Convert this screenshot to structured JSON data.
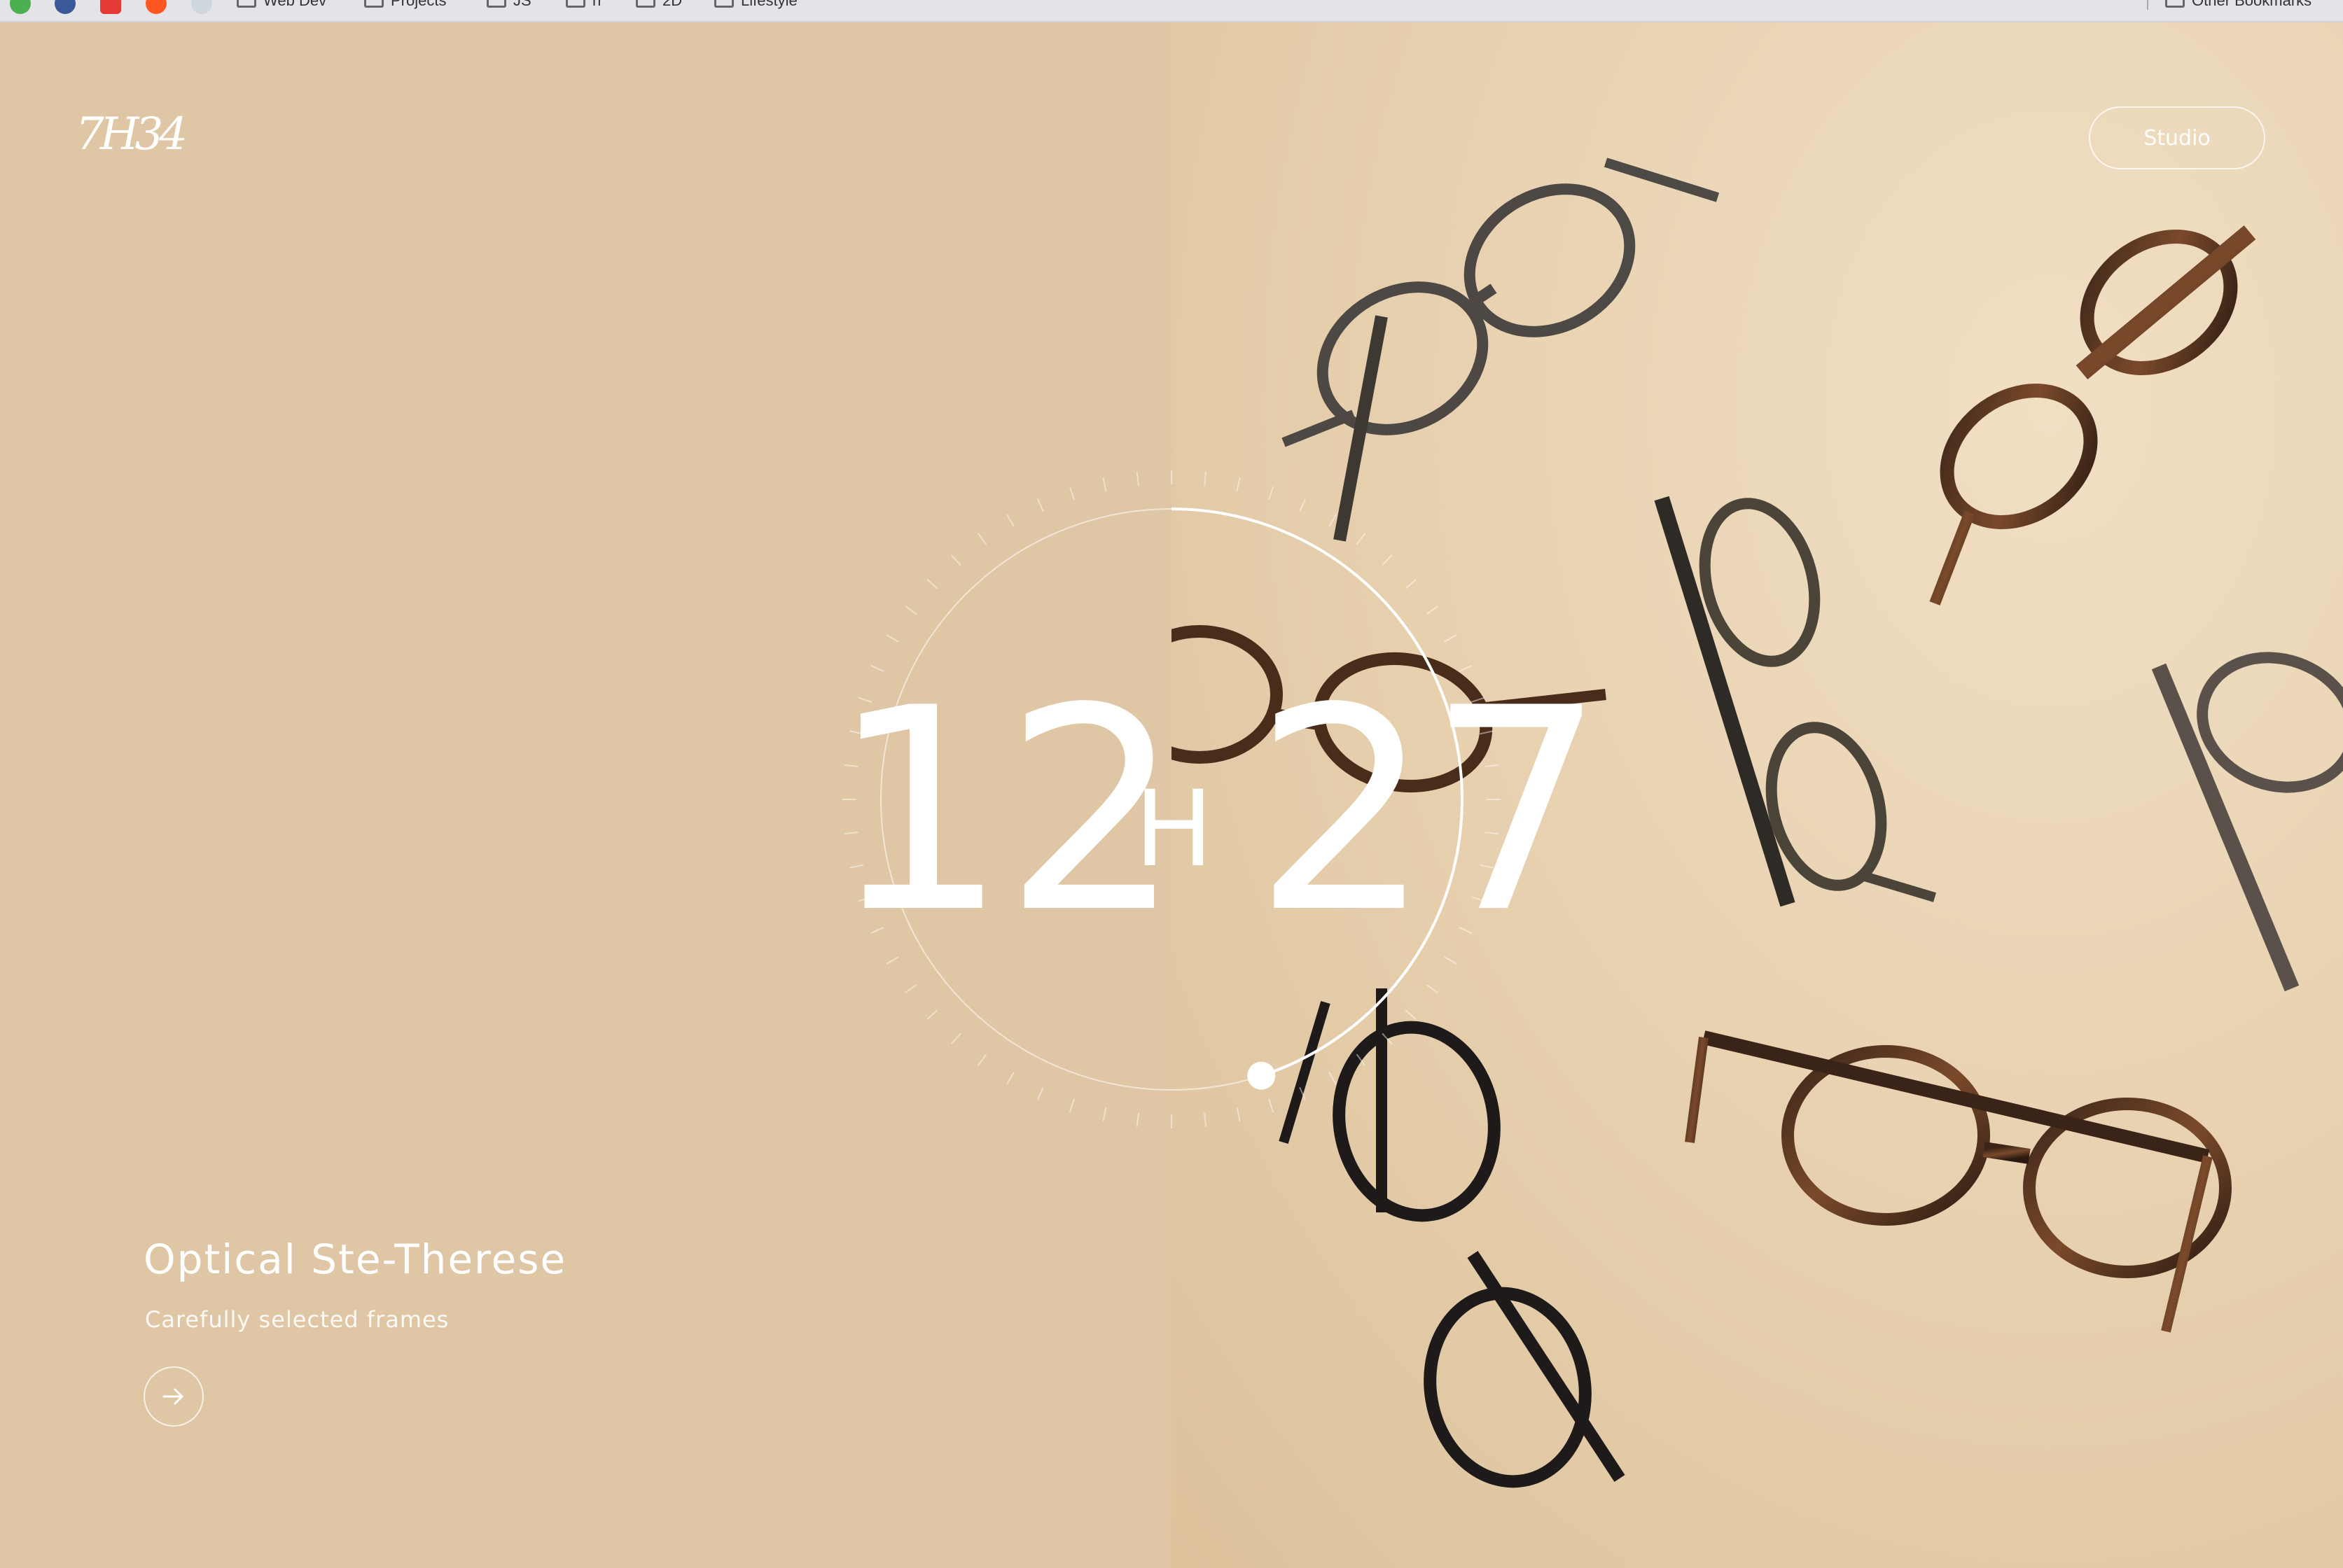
{
  "browser": {
    "bookmarks": [
      "Web Dev",
      "Projects",
      "JS",
      "rr",
      "2D",
      "Lifestyle"
    ],
    "other_bookmarks": "Other Bookmarks"
  },
  "brand": {
    "logo_text": "7H34"
  },
  "nav": {
    "studio_label": "Studio"
  },
  "clock": {
    "hours": "12",
    "separator": "H",
    "minutes": "27",
    "minute_progress": 0.45
  },
  "hero": {
    "title": "Optical Ste-Therese",
    "subtitle": "Carefully selected frames",
    "cta_icon": "arrow-right-icon"
  },
  "colors": {
    "left_background": "#dfc6a4",
    "text": "#ffffff"
  }
}
